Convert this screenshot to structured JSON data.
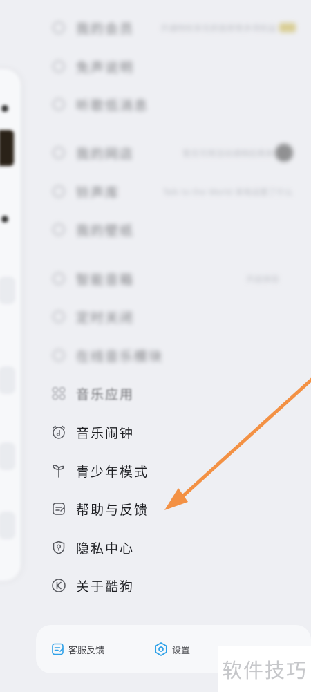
{
  "menu": {
    "blurred_items": [
      {
        "label": "我的会员",
        "sub": "开通特权享无损音质等多项权益"
      },
      {
        "label": "免声说明",
        "sub": ""
      },
      {
        "label": "听歌低消息",
        "sub": ""
      },
      {
        "label": "我的网店",
        "sub": "暂无可用活动请稍后再来"
      },
      {
        "label": "铃声库",
        "sub": "Talk to the World 来电设置了什么"
      },
      {
        "label": "我的壁纸",
        "sub": ""
      },
      {
        "label": "智能音箱",
        "sub": "开启体验"
      },
      {
        "label": "定时关闭",
        "sub": ""
      },
      {
        "label": "在线音乐模块",
        "sub": ""
      }
    ],
    "semi_item": {
      "label": "音乐应用",
      "icon": "grid-icon"
    },
    "items": [
      {
        "label": "音乐闹钟",
        "icon": "alarm-clock-icon"
      },
      {
        "label": "青少年模式",
        "icon": "sprout-icon"
      },
      {
        "label": "帮助与反馈",
        "icon": "help-feedback-icon"
      },
      {
        "label": "隐私中心",
        "icon": "privacy-shield-icon"
      },
      {
        "label": "关于酷狗",
        "icon": "kugou-k-icon"
      }
    ]
  },
  "bottom_bar": {
    "service_label": "客服反馈",
    "settings_label": "设置"
  },
  "watermark": "软件技巧",
  "colors": {
    "accent": "#2ea1e8",
    "arrow": "#f39144"
  }
}
